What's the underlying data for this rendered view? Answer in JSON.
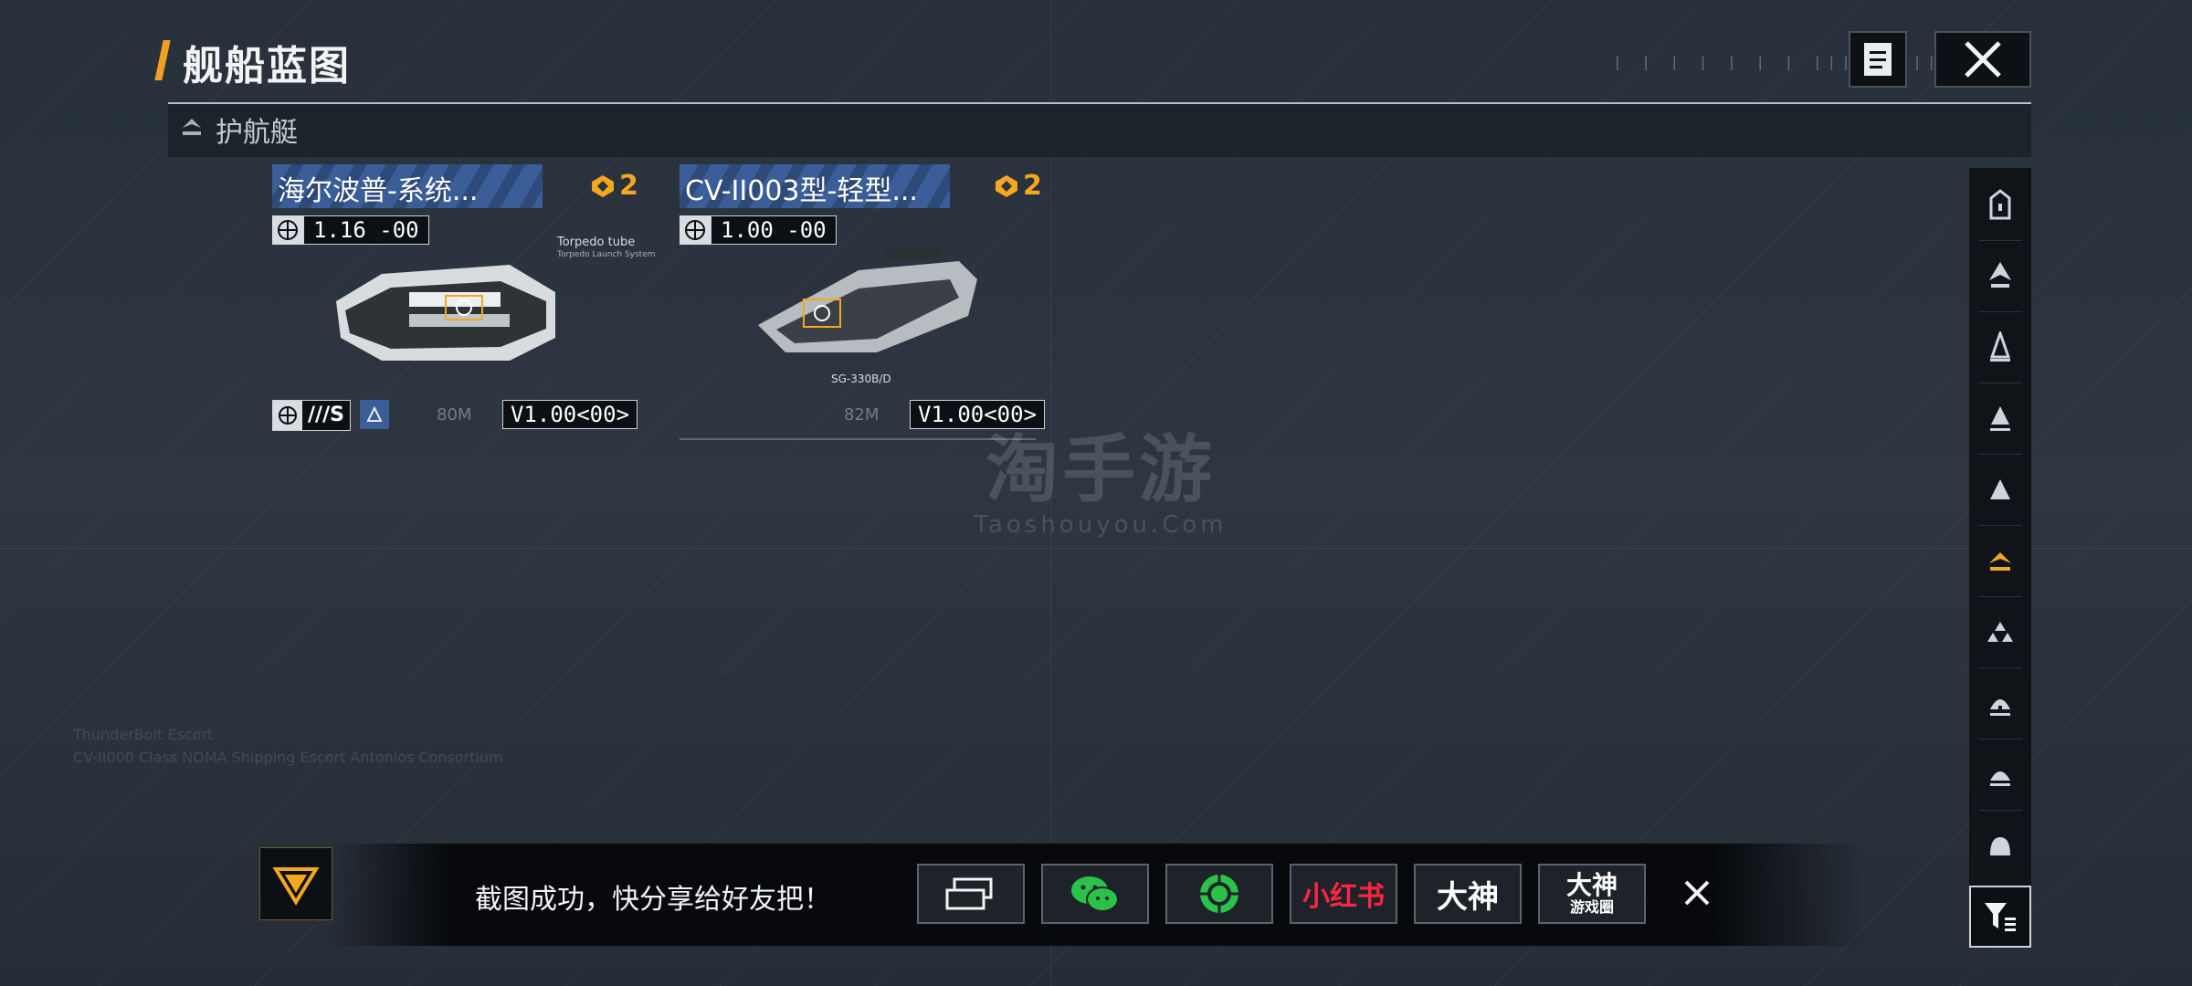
{
  "header": {
    "title": "舰船蓝图",
    "notes_icon": "notes-icon",
    "close_icon": "close-icon"
  },
  "category": {
    "label": "护航艇",
    "icon": "escort-ship-icon"
  },
  "cards": [
    {
      "name": "海尔波普-系统...",
      "badge_count": "2",
      "stat_value": "1.16 -00",
      "annotation": "Torpedo tube",
      "annotation_sub": "Torpedo Launch System",
      "tag": "///S",
      "range": "80M",
      "version": "V1.00<00>"
    },
    {
      "name": "CV-II003型-轻型...",
      "badge_count": "2",
      "stat_value": "1.00 -00",
      "annotation": "SG-330B/D",
      "range": "82M",
      "version": "V1.00<00>"
    }
  ],
  "sidebar": {
    "items": [
      {
        "icon": "carrier-class-icon"
      },
      {
        "icon": "battleship-class-icon"
      },
      {
        "icon": "cruiser-class-icon"
      },
      {
        "icon": "destroyer-class-icon"
      },
      {
        "icon": "frigate-class-icon"
      },
      {
        "icon": "escort-ship-icon"
      },
      {
        "icon": "fighter-squadron-icon"
      },
      {
        "icon": "corvette-class-icon"
      },
      {
        "icon": "support-class-icon"
      },
      {
        "icon": "transport-class-icon"
      }
    ],
    "filter_icon": "filter-icon",
    "active_color": "#f4a81e"
  },
  "share_bar": {
    "message": "截图成功，快分享给好友把！",
    "buttons": [
      {
        "icon": "screenshot-share-icon"
      },
      {
        "icon": "wechat-icon"
      },
      {
        "icon": "moments-icon"
      },
      {
        "label": "小红书"
      },
      {
        "label": "大神"
      },
      {
        "label": "大神",
        "sublabel": "游戏圈"
      }
    ],
    "close_icon": "close-icon"
  },
  "watermark": {
    "title": "淘手游",
    "url": "Taoshouyou.Com"
  },
  "colors": {
    "accent": "#f4a81e",
    "name_bar": "#3b5e98",
    "background": "#2a323d",
    "xiaohongshu_red": "#ff2442",
    "wechat_green": "#2bc24a"
  }
}
